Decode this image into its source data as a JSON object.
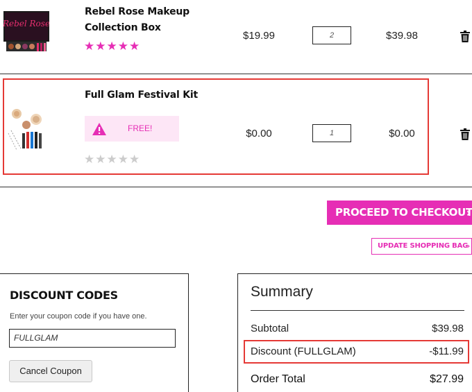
{
  "items": [
    {
      "name_line1": "Rebel Rose Makeup",
      "name_line2": "Collection Box",
      "image_text": "Rebel Rose",
      "rating": 5,
      "unit_price": "$19.99",
      "quantity": "2",
      "total": "$39.98"
    },
    {
      "name_line1": "Full Glam Festival Kit",
      "badge_text": "FREE!",
      "rating": 0,
      "unit_price": "$0.00",
      "quantity": "1",
      "total": "$0.00"
    }
  ],
  "actions": {
    "checkout_label": "PROCEED TO CHECKOUT",
    "update_label": "UPDATE SHOPPING BAG"
  },
  "discount": {
    "title": "DISCOUNT CODES",
    "subtitle": "Enter your coupon code if you have one.",
    "code_value": "FULLGLAM",
    "cancel_label": "Cancel Coupon"
  },
  "summary": {
    "title": "Summary",
    "subtotal_label": "Subtotal",
    "subtotal_value": "$39.98",
    "discount_label": "Discount (FULLGLAM)",
    "discount_value": "-$11.99",
    "total_label": "Order Total",
    "total_value": "$27.99"
  },
  "colors": {
    "accent": "#e62eb5",
    "highlight": "#e53935",
    "badge_bg": "#fde6f6"
  },
  "icons": {
    "trash": "trash-icon",
    "warning": "warning-icon",
    "chevron": "chevron-right-icon",
    "star": "star-icon"
  }
}
